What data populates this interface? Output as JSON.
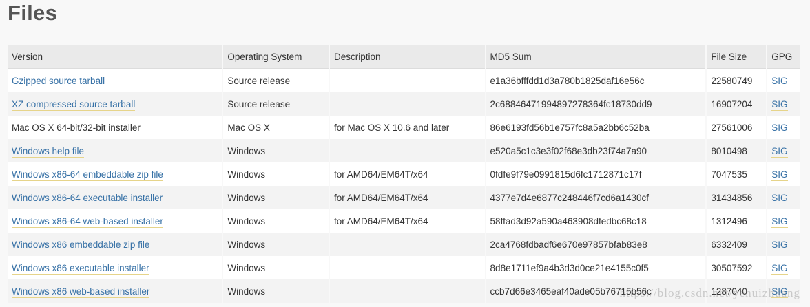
{
  "page": {
    "title": "Files",
    "watermark": "https://blog.csdn.net/yehuizhuang"
  },
  "table": {
    "headers": {
      "version": "Version",
      "os": "Operating System",
      "description": "Description",
      "md5": "MD5 Sum",
      "size": "File Size",
      "gpg": "GPG"
    },
    "rows": [
      {
        "version": "Gzipped source tarball",
        "os": "Source release",
        "description": "",
        "md5": "e1a36bfffdd1d3a780b1825daf16e56c",
        "size": "22580749",
        "gpg": "SIG"
      },
      {
        "version": "XZ compressed source tarball",
        "os": "Source release",
        "description": "",
        "md5": "2c68846471994897278364fc18730dd9",
        "size": "16907204",
        "gpg": "SIG"
      },
      {
        "version": "Mac OS X 64-bit/32-bit installer",
        "os": "Mac OS X",
        "description": "for Mac OS X 10.6 and later",
        "md5": "86e6193fd56b1e757fc8a5a2bb6c52ba",
        "size": "27561006",
        "gpg": "SIG"
      },
      {
        "version": "Windows help file",
        "os": "Windows",
        "description": "",
        "md5": "e520a5c1c3e3f02f68e3db23f74a7a90",
        "size": "8010498",
        "gpg": "SIG"
      },
      {
        "version": "Windows x86-64 embeddable zip file",
        "os": "Windows",
        "description": "for AMD64/EM64T/x64",
        "md5": "0fdfe9f79e0991815d6fc1712871c17f",
        "size": "7047535",
        "gpg": "SIG"
      },
      {
        "version": "Windows x86-64 executable installer",
        "os": "Windows",
        "description": "for AMD64/EM64T/x64",
        "md5": "4377e7d4e6877c248446f7cd6a1430cf",
        "size": "31434856",
        "gpg": "SIG"
      },
      {
        "version": "Windows x86-64 web-based installer",
        "os": "Windows",
        "description": "for AMD64/EM64T/x64",
        "md5": "58ffad3d92a590a463908dfedbc68c18",
        "size": "1312496",
        "gpg": "SIG"
      },
      {
        "version": "Windows x86 embeddable zip file",
        "os": "Windows",
        "description": "",
        "md5": "2ca4768fdbadf6e670e97857bfab83e8",
        "size": "6332409",
        "gpg": "SIG"
      },
      {
        "version": "Windows x86 executable installer",
        "os": "Windows",
        "description": "",
        "md5": "8d8e1711ef9a4b3d3d0ce21e4155c0f5",
        "size": "30507592",
        "gpg": "SIG"
      },
      {
        "version": "Windows x86 web-based installer",
        "os": "Windows",
        "description": "",
        "md5": "ccb7d66e3465eaf40ade05b76715b56c",
        "size": "1287040",
        "gpg": "SIG"
      }
    ]
  },
  "colors": {
    "link": "#3771a6",
    "link_underline": "#e6d48a",
    "header_bg": "#eaeaea",
    "row_odd": "#ffffff",
    "row_even": "#f3f3f3",
    "page_bg": "#f8f8f8"
  }
}
